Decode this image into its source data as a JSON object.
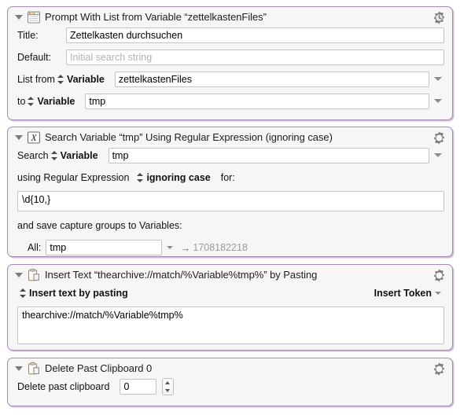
{
  "window": {
    "app": "Keyboard Maestro Action Editor",
    "background": "#ffffff",
    "action_border_color": "#a888b8",
    "action_fill_color": "#f7f6f7"
  },
  "actions": [
    {
      "id": "prompt-with-list",
      "icon": "window-form-icon",
      "gear_icon": "gear-clock-icon",
      "title": "Prompt With List from Variable “zettelkastenFiles”",
      "fields": {
        "title_label": "Title:",
        "title_value": "Zettelkasten durchsuchen",
        "default_label": "Default:",
        "default_value": "",
        "default_placeholder": "Initial search string",
        "list_from_label": "List from",
        "list_from_source": "Variable",
        "list_from_value": "zettelkastenFiles",
        "to_label": "to",
        "to_source": "Variable",
        "to_value": "tmp"
      }
    },
    {
      "id": "search-variable",
      "icon": "variable-x-icon",
      "gear_icon": "gear-icon",
      "title": "Search Variable “tmp” Using Regular Expression (ignoring case)",
      "fields": {
        "search_label": "Search",
        "search_source": "Variable",
        "search_value": "tmp",
        "using_label": "using Regular Expression",
        "case_option": "ignoring case",
        "for_label": "for:",
        "regex_value": "\\d{10,}",
        "capture_label": "and save capture groups to Variables:",
        "all_label": "All:",
        "all_value": "tmp",
        "all_arrow": "→",
        "all_result": "1708182218"
      }
    },
    {
      "id": "insert-text",
      "icon": "clipboard-paste-icon",
      "gear_icon": "gear-icon",
      "title": "Insert Text “thearchive://match/%Variable%tmp%” by Pasting",
      "fields": {
        "method_label": "Insert text by pasting",
        "insert_token_label": "Insert Token",
        "text_value": "thearchive://match/%Variable%tmp%"
      }
    },
    {
      "id": "delete-past-clipboard",
      "icon": "clipboard-paste-icon",
      "gear_icon": "gear-icon",
      "title": "Delete Past Clipboard 0",
      "fields": {
        "delete_label": "Delete past clipboard",
        "delete_value": "0"
      }
    }
  ]
}
